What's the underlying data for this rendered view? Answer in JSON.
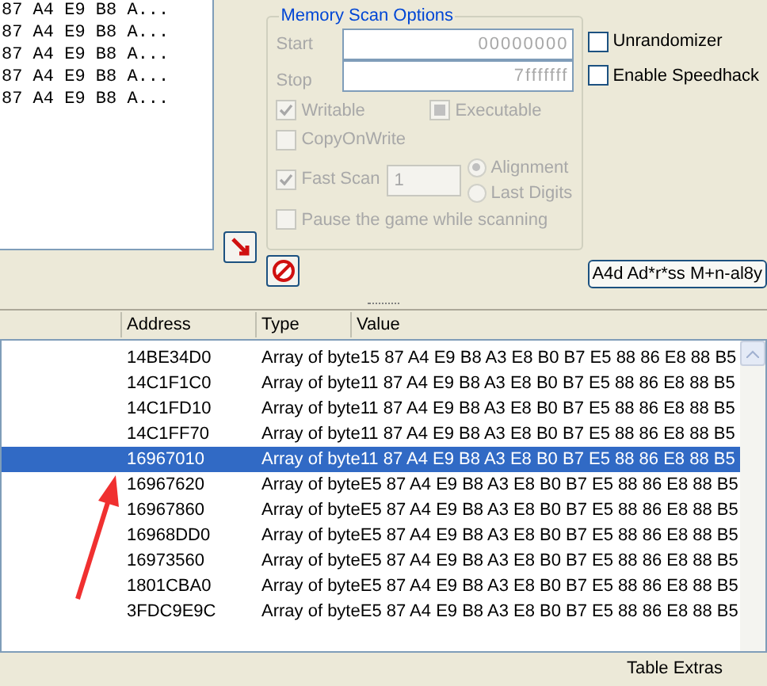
{
  "hex_lines": [
    "87 A4 E9 B8 A...",
    "87 A4 E9 B8 A...",
    "87 A4 E9 B8 A...",
    "87 A4 E9 B8 A...",
    "87 A4 E9 B8 A..."
  ],
  "memory_scan_options": {
    "title": "Memory Scan Options",
    "start_label": "Start",
    "start_value": "00000000",
    "stop_label": "Stop",
    "stop_value": "7fffffff",
    "flags": [
      {
        "label": "Writable",
        "checked": true,
        "kind": "tick"
      },
      {
        "label": "Executable",
        "checked": true,
        "kind": "grayed"
      },
      {
        "label": "CopyOnWrite",
        "checked": false,
        "kind": "tick"
      }
    ],
    "fast_scan": {
      "label": "Fast Scan",
      "checked": true,
      "value": "1"
    },
    "alignment": [
      {
        "label": "Alignment",
        "selected": true
      },
      {
        "label": "Last Digits",
        "selected": false
      }
    ],
    "pause": {
      "label": "Pause the game while scanning",
      "checked": false
    }
  },
  "side_options": [
    {
      "label": "Unrandomizer",
      "checked": false
    },
    {
      "label": "Enable Speedhack",
      "checked": false
    }
  ],
  "add_address_button": "A4d Ad*r*ss M+n-al8y",
  "columns": [
    "Address",
    "Type",
    "Value"
  ],
  "rows": [
    {
      "address": "14BE34D0",
      "type": "Array of byte",
      "value": "15 87 A4 E9 B8 A3 E8 B0 B7 E5 88 86 E8 88 B5",
      "selected": false
    },
    {
      "address": "14C1F1C0",
      "type": "Array of byte",
      "value": "11 87 A4 E9 B8 A3 E8 B0 B7 E5 88 86 E8 88 B5",
      "selected": false
    },
    {
      "address": "14C1FD10",
      "type": "Array of byte",
      "value": "11 87 A4 E9 B8 A3 E8 B0 B7 E5 88 86 E8 88 B5",
      "selected": false
    },
    {
      "address": "14C1FF70",
      "type": "Array of byte",
      "value": "11 87 A4 E9 B8 A3 E8 B0 B7 E5 88 86 E8 88 B5",
      "selected": false
    },
    {
      "address": "16967010",
      "type": "Array of byte",
      "value": "11 87 A4 E9 B8 A3 E8 B0 B7 E5 88 86 E8 88 B5",
      "selected": true
    },
    {
      "address": "16967620",
      "type": "Array of byte",
      "value": "E5 87 A4 E9 B8 A3 E8 B0 B7 E5 88 86 E8 88 B5",
      "selected": false
    },
    {
      "address": "16967860",
      "type": "Array of byte",
      "value": "E5 87 A4 E9 B8 A3 E8 B0 B7 E5 88 86 E8 88 B5",
      "selected": false
    },
    {
      "address": "16968DD0",
      "type": "Array of byte",
      "value": "E5 87 A4 E9 B8 A3 E8 B0 B7 E5 88 86 E8 88 B5",
      "selected": false
    },
    {
      "address": "16973560",
      "type": "Array of byte",
      "value": "E5 87 A4 E9 B8 A3 E8 B0 B7 E5 88 86 E8 88 B5",
      "selected": false
    },
    {
      "address": "1801CBA0",
      "type": "Array of byte",
      "value": "E5 87 A4 E9 B8 A3 E8 B0 B7 E5 88 86 E8 88 B5",
      "selected": false
    },
    {
      "address": "3FDC9E9C",
      "type": "Array of byte",
      "value": "E5 87 A4 E9 B8 A3 E8 B0 B7 E5 88 86 E8 88 B5",
      "selected": false
    }
  ],
  "footer": "Table Extras"
}
